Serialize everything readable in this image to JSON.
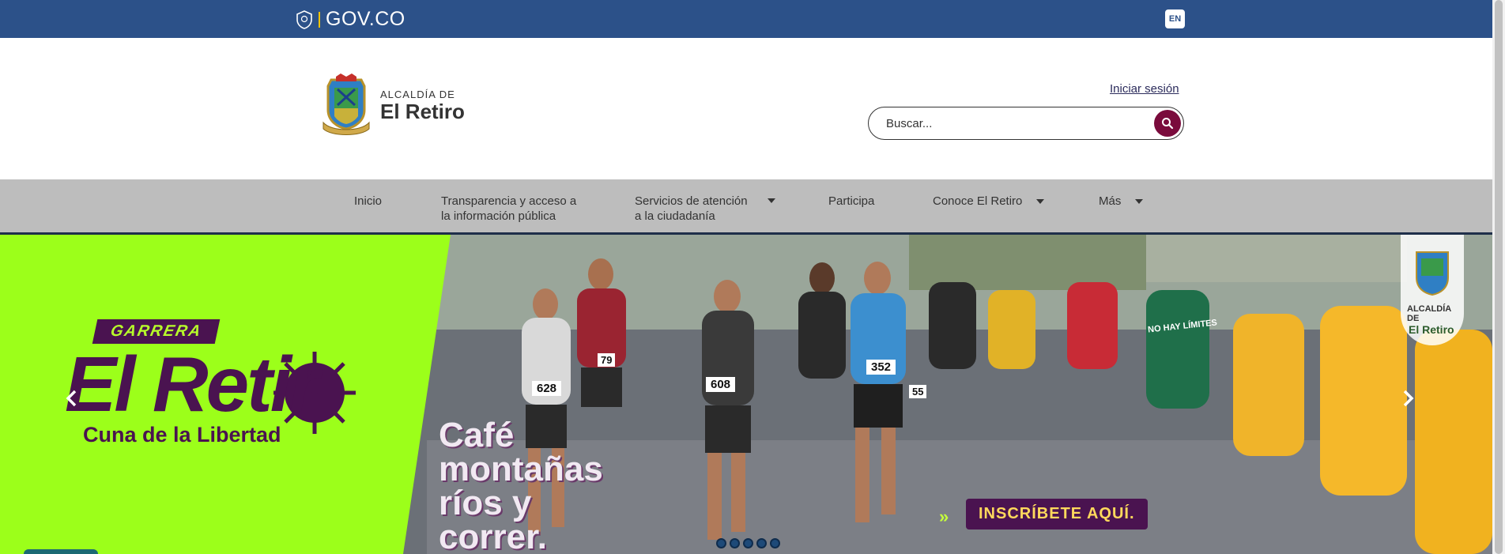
{
  "govbar": {
    "logo_text": "GOV.CO",
    "lang_label": "EN"
  },
  "header": {
    "brand_line1": "ALCALDÍA DE",
    "brand_line2": "El Retiro",
    "login_label": "Iniciar sesión",
    "search_placeholder": "Buscar..."
  },
  "nav": {
    "items": [
      {
        "label": "Inicio"
      },
      {
        "label_line1": "Transparencia y acceso a",
        "label_line2": "la información pública"
      },
      {
        "label_line1": "Servicios de atención",
        "label_line2": "a la ciudadanía"
      },
      {
        "label": "Participa"
      },
      {
        "label": "Conoce El Retiro"
      },
      {
        "label": "Más"
      }
    ]
  },
  "hero": {
    "tag": "GARRERA",
    "title": "El Retir",
    "subtitle": "Cuna de la Libertad",
    "slogan": [
      "Café",
      "montañas",
      "ríos y",
      "correr."
    ],
    "cta": "INSCRÍBETE AQUÍ.",
    "cta_arrows": "»",
    "bibs": [
      "628",
      "608",
      "352",
      "79",
      "55"
    ],
    "jersey_text": "NO HAY LÍMITES",
    "badge_line1": "ALCALDÍA DE",
    "badge_line2": "El Retiro",
    "dots_count": 5
  },
  "colors": {
    "govbar": "#2c5189",
    "nav": "#bdbdbd",
    "brand_purple": "#4a1350",
    "lime": "#9cff1a",
    "search_button": "#7a0b3c"
  },
  "icons": {
    "search": "search-icon",
    "prev": "chevron-left-icon",
    "next": "chevron-right-icon",
    "caret": "caret-down-icon"
  }
}
